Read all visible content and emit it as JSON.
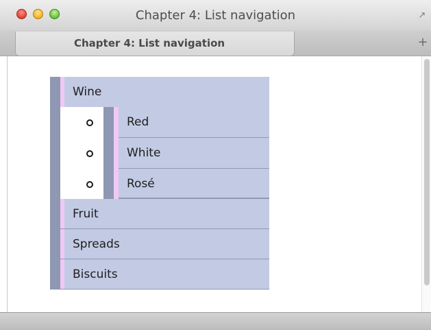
{
  "window": {
    "title": "Chapter 4: List navigation"
  },
  "tabbar": {
    "tab_label": "Chapter 4: List navigation",
    "add_tab": "+"
  },
  "nav": {
    "wine": "Wine",
    "wine_sub": [
      "Red",
      "White",
      "Rosé"
    ],
    "fruit": "Fruit",
    "spreads": "Spreads",
    "biscuits": "Biscuits"
  },
  "colors": {
    "item_bg": "#c3cbe4",
    "bar": "#8e98b2",
    "accent": "#f0c8f4"
  }
}
